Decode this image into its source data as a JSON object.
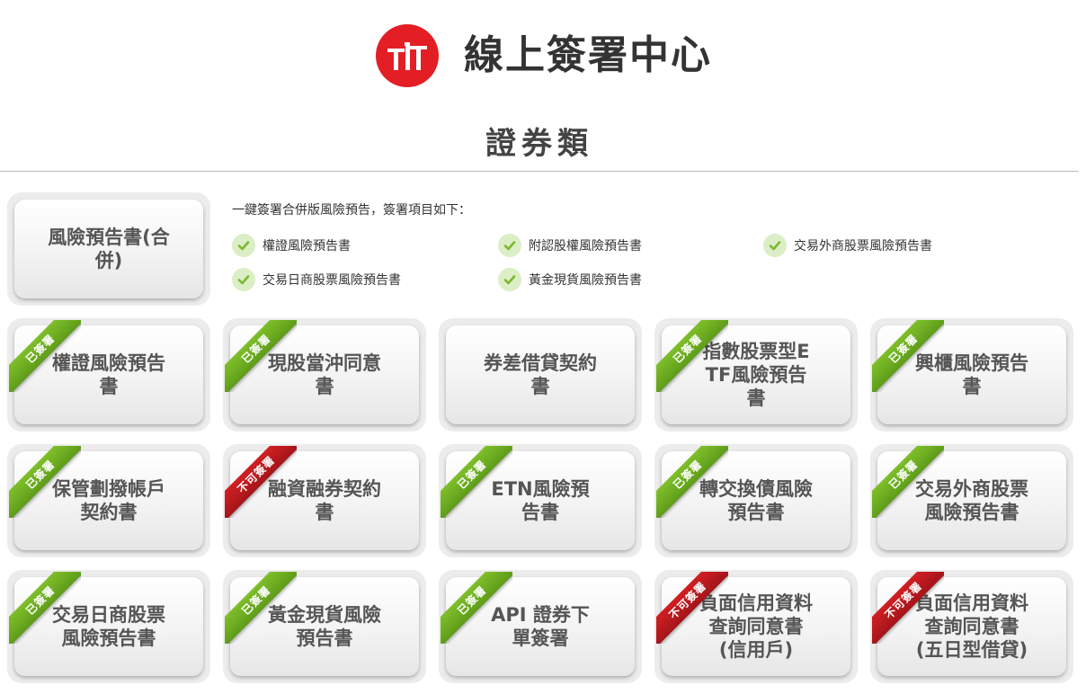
{
  "header": {
    "title": "線上簽署中心",
    "logo_icon": "tfc-logo",
    "brand_color": "#e31f25"
  },
  "section": {
    "title": "證券類"
  },
  "combined": {
    "label": "風險預告書(合併)",
    "intro": "一鍵簽署合併版風險預告，簽署項目如下：",
    "items": [
      "權證風險預告書",
      "附認股權風險預告書",
      "交易外商股票風險預告書",
      "交易日商股票風險預告書",
      "黃金現貨風險預告書"
    ]
  },
  "status_labels": {
    "signed": "已簽署",
    "not_allowed": "不可簽署"
  },
  "documents": [
    {
      "label": "權證風險預告書",
      "status": "signed"
    },
    {
      "label": "現股當沖同意書",
      "status": "signed"
    },
    {
      "label": "券差借貸契約書",
      "status": ""
    },
    {
      "label": "指數股票型ETF風險預告書",
      "status": "signed"
    },
    {
      "label": "興櫃風險預告書",
      "status": "signed"
    },
    {
      "label": "保管劃撥帳戶契約書",
      "status": "signed"
    },
    {
      "label": "融資融券契約書",
      "status": "not_allowed"
    },
    {
      "label": "ETN風險預告書",
      "status": "signed"
    },
    {
      "label": "轉交換債風險預告書",
      "status": "signed"
    },
    {
      "label": "交易外商股票風險預告書",
      "status": "signed"
    },
    {
      "label": "交易日商股票風險預告書",
      "status": "signed"
    },
    {
      "label": "黃金現貨風險預告書",
      "status": "signed"
    },
    {
      "label": "API 證券下單簽署",
      "status": "signed"
    },
    {
      "label": "負面信用資料查詢同意書(信用戶)",
      "status": "not_allowed"
    },
    {
      "label": "負面信用資料查詢同意書(五日型借貸)",
      "status": "not_allowed"
    }
  ],
  "colors": {
    "signed_ribbon": "#6aab1f",
    "not_allowed_ribbon": "#c0181d",
    "check": "#7cb82f"
  }
}
